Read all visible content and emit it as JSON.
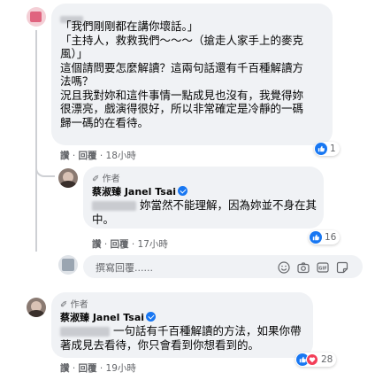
{
  "comment1": {
    "lines": [
      "「我們剛剛都在講你壞話。」",
      "「主持人，救救我們～～～（搶走人家手上的麥克",
      "風）」",
      "這個請問要怎麼解讀？這兩句話還有千百種解讀方",
      "法嗎？",
      "況且我對妳和這件事情一點成見也沒有，我覺得妳",
      "很漂亮，戲演得很好，所以非常確定是冷靜的一碼",
      "歸一碼的在看待。"
    ],
    "like_label": "讚",
    "reply_label": "回覆",
    "time": "18小時",
    "reaction_count": "1"
  },
  "reply1": {
    "author_badge": "作者",
    "author_name": "蔡淑臻 Janel Tsai",
    "line1": "妳當然不能理解，因為妳並不身在其",
    "line2": "中。",
    "like_label": "讚",
    "reply_label": "回覆",
    "time": "17小時",
    "reaction_count": "16"
  },
  "reply_input": {
    "placeholder": "撰寫回覆......"
  },
  "comment2": {
    "author_badge": "作者",
    "author_name": "蔡淑臻 Janel Tsai",
    "line1": "一句話有千百種解讀的方法，如果你帶",
    "line2": "著成見去看待，你只會看到你想看到的。",
    "like_label": "讚",
    "reply_label": "回覆",
    "time": "19小時",
    "reaction_count": "28"
  },
  "colors": {
    "bubble": "#f0f2f5",
    "like_blue": "#1877f2",
    "love_red": "#f33e58",
    "meta_gray": "#65676b"
  }
}
